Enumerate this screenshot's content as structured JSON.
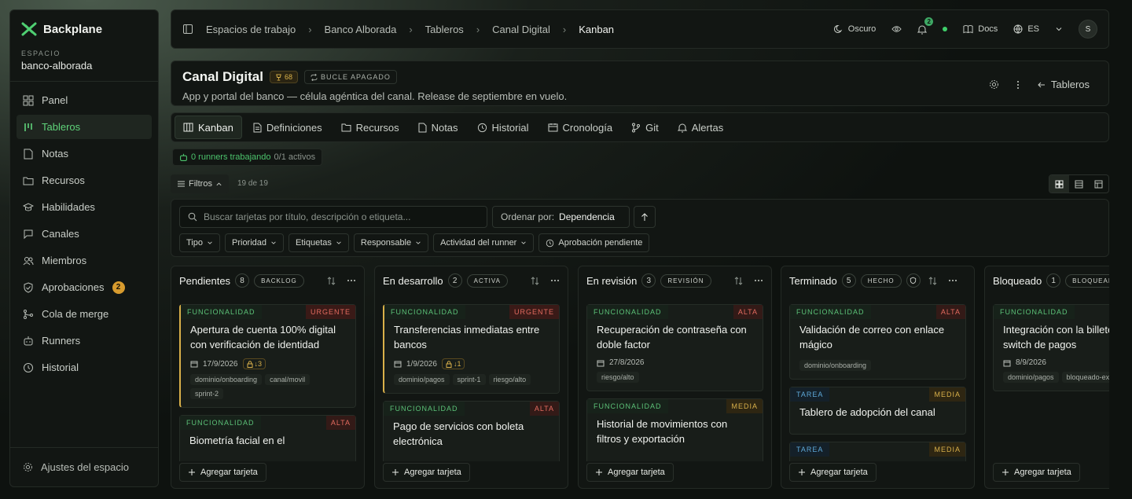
{
  "brand": {
    "name": "Backplane"
  },
  "workspace": {
    "label": "ESPACIO",
    "name": "banco-alborada"
  },
  "sidebar": {
    "items": [
      {
        "label": "Panel"
      },
      {
        "label": "Tableros"
      },
      {
        "label": "Notas"
      },
      {
        "label": "Recursos"
      },
      {
        "label": "Habilidades"
      },
      {
        "label": "Canales"
      },
      {
        "label": "Miembros"
      },
      {
        "label": "Aprobaciones",
        "badge": "2"
      },
      {
        "label": "Cola de merge"
      },
      {
        "label": "Runners"
      },
      {
        "label": "Historial"
      }
    ],
    "footer": "Ajustes del espacio"
  },
  "breadcrumb": [
    "Espacios de trabajo",
    "Banco Alborada",
    "Tableros",
    "Canal Digital",
    "Kanban"
  ],
  "topbar": {
    "theme": "Oscuro",
    "notifications": "2",
    "docs": "Docs",
    "lang": "ES",
    "avatar": "S"
  },
  "board": {
    "title": "Canal Digital",
    "score": "68",
    "loop": "BUCLE APAGADO",
    "description": "App y portal del banco — célula agéntica del canal. Release de septiembre en vuelo.",
    "back": "Tableros"
  },
  "tabs": [
    "Kanban",
    "Definiciones",
    "Recursos",
    "Notas",
    "Historial",
    "Cronología",
    "Git",
    "Alertas"
  ],
  "runners": {
    "working": "0 runners trabajando",
    "active": "0/1 activos"
  },
  "filters": {
    "label": "Filtros",
    "count": "19 de 19"
  },
  "search": {
    "placeholder": "Buscar tarjetas por título, descripción o etiqueta...",
    "sort_label": "Ordenar por:",
    "sort_value": "Dependencia",
    "chips": [
      "Tipo",
      "Prioridad",
      "Etiquetas",
      "Responsable",
      "Actividad del runner",
      "Aprobación pendiente"
    ]
  },
  "add_card": "Agregar tarjeta",
  "columns": [
    {
      "title": "Pendientes",
      "count": "8",
      "tag": "BACKLOG",
      "cards": [
        {
          "type": "FUNCIONALIDAD",
          "prio": "URGENTE",
          "title": "Apertura de cuenta 100% digital con verificación de identidad",
          "date": "17/9/2026",
          "lock": "↓3",
          "tags": [
            "dominio/onboarding",
            "canal/movil",
            "sprint-2"
          ]
        },
        {
          "type": "FUNCIONALIDAD",
          "prio": "ALTA",
          "title": "Biometría facial en el"
        }
      ]
    },
    {
      "title": "En desarrollo",
      "count": "2",
      "tag": "ACTIVA",
      "cards": [
        {
          "type": "FUNCIONALIDAD",
          "prio": "URGENTE",
          "title": "Transferencias inmediatas entre bancos",
          "date": "1/9/2026",
          "lock": "↓1",
          "tags": [
            "dominio/pagos",
            "sprint-1",
            "riesgo/alto"
          ]
        },
        {
          "type": "FUNCIONALIDAD",
          "prio": "ALTA",
          "title": "Pago de servicios con boleta electrónica"
        }
      ]
    },
    {
      "title": "En revisión",
      "count": "3",
      "tag": "REVISIÓN",
      "cards": [
        {
          "type": "FUNCIONALIDAD",
          "prio": "ALTA",
          "title": "Recuperación de contraseña con doble factor",
          "date": "27/8/2026",
          "tags": [
            "riesgo/alto"
          ]
        },
        {
          "type": "FUNCIONALIDAD",
          "prio": "MEDIA",
          "title": "Historial de movimientos con filtros y exportación"
        }
      ]
    },
    {
      "title": "Terminado",
      "count": "5",
      "tag": "HECHO",
      "cards": [
        {
          "type": "FUNCIONALIDAD",
          "prio": "ALTA",
          "title": "Validación de correo con enlace mágico",
          "tags": [
            "dominio/onboarding"
          ]
        },
        {
          "type": "TAREA",
          "prio": "MEDIA",
          "title": "Tablero de adopción del canal"
        },
        {
          "type": "TAREA",
          "prio": "MEDIA",
          "title": ""
        }
      ]
    },
    {
      "title": "Bloqueado",
      "count": "1",
      "tag": "BLOQUEADA",
      "cards": [
        {
          "type": "FUNCIONALIDAD",
          "prio": "",
          "title": "Integración con la billetera switch de pagos",
          "date": "8/9/2026",
          "tags": [
            "dominio/pagos",
            "bloqueado-ext"
          ]
        }
      ]
    }
  ],
  "colors": {
    "accent": "#5fd37a",
    "urgent": "#e36b5f",
    "medium": "#d9b04a",
    "task": "#5ea8d8"
  }
}
